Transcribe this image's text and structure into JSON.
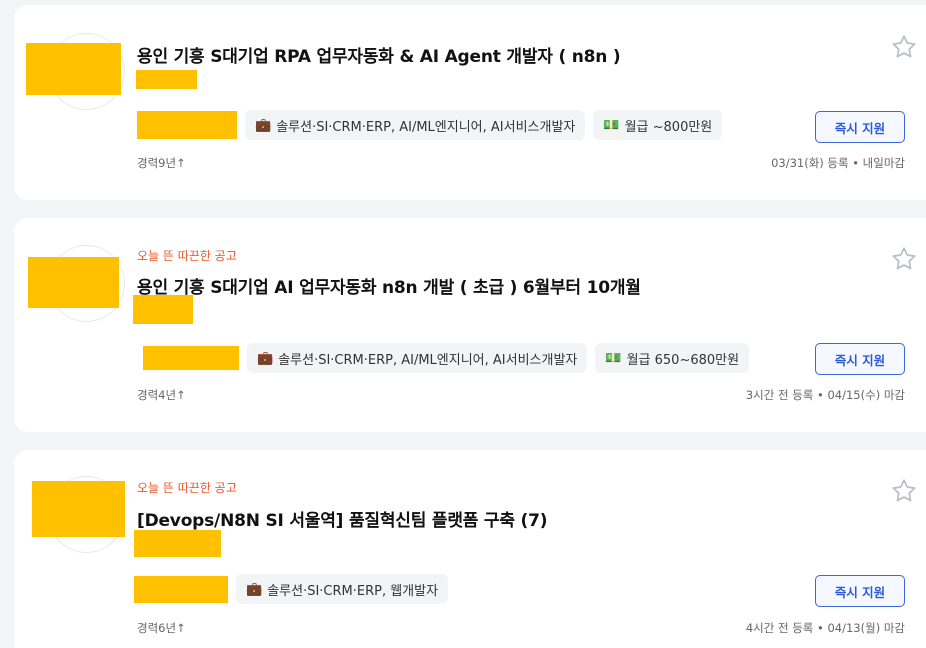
{
  "jobs": [
    {
      "hot_label": "",
      "title": "용인 기흥 S대기업 RPA 업무자동화 & AI Agent 개발자 ( n8n )",
      "category": "솔루션·SI·CRM·ERP, AI/ML엔지니어, AI서비스개발자",
      "salary": "월급 ~800만원",
      "experience": "경력9년↑",
      "posted": "03/31(화) 등록 • 내일마감",
      "apply_label": "즉시 지원",
      "category_icon": "briefcase-icon",
      "salary_icon": "money-icon"
    },
    {
      "hot_label": "오늘 뜬 따끈한 공고",
      "title": "용인 기흥 S대기업 AI 업무자동화 n8n 개발 ( 초급 ) 6월부터 10개월",
      "category": "솔루션·SI·CRM·ERP, AI/ML엔지니어, AI서비스개발자",
      "salary": "월급 650~680만원",
      "experience": "경력4년↑",
      "posted": "3시간 전 등록 • 04/15(수) 마감",
      "apply_label": "즉시 지원",
      "category_icon": "briefcase-icon",
      "salary_icon": "money-icon"
    },
    {
      "hot_label": "오늘 뜬 따끈한 공고",
      "title": "[Devops/N8N SI 서울역] 품질혁신팀 플랫폼 구축 (7)",
      "category": "솔루션·SI·CRM·ERP, 웹개발자",
      "salary": "",
      "experience": "경력6년↑",
      "posted": "4시간 전 등록 • 04/13(월) 마감",
      "apply_label": "즉시 지원",
      "category_icon": "briefcase-icon",
      "salary_icon": ""
    }
  ],
  "colors": {
    "hot": "#e8582a",
    "accent": "#2d5bd8",
    "redaction": "#ffc000"
  }
}
